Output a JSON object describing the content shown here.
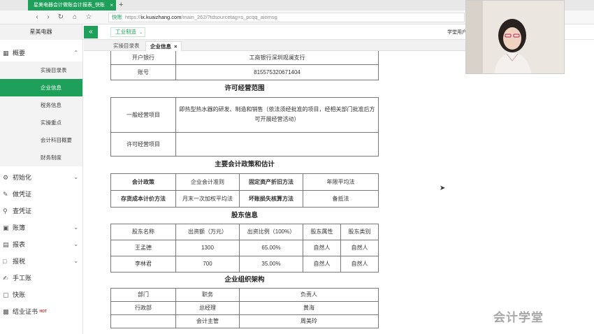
{
  "browser": {
    "tab_title": "星美电器会计做账会计报表_快账",
    "tab_close": "×",
    "new_tab": "+",
    "url_safe": "快账",
    "url_prefix": "https://",
    "url_domain": "ix.kuaizhang.com",
    "url_path": "/main_262/?tdsourcetag=s_pcqq_aiomsg"
  },
  "header": {
    "brand": "星美电器",
    "collapse": "«",
    "industry": "工业制造",
    "study_user": "学堂用户"
  },
  "content_tabs": [
    {
      "label": "实操目录表"
    },
    {
      "label": "企业信息",
      "close": "×"
    }
  ],
  "sidebar": {
    "overview": "概要",
    "subs": [
      "实操目录表",
      "企业信息",
      "税务信息",
      "实操重点",
      "会计科目概要",
      "财务制度"
    ],
    "groups": [
      "初始化",
      "做凭证",
      "查凭证",
      "账簿",
      "报表",
      "报税",
      "手工账",
      "快账",
      "结业证书"
    ],
    "hot": "HOT"
  },
  "bank": {
    "bank_label": "开户银行",
    "bank_value": "工商银行深圳观澜支行",
    "acct_label": "账号",
    "acct_value": "815575320671404"
  },
  "scope": {
    "title": "许可经营范围",
    "general_label": "一般经营项目",
    "general_value": "即热型热水器的研发、制造和销售（依法须经批准的项目，经相关部门批准后方可开展经营活动）",
    "licensed_label": "许可经营项目",
    "licensed_value": ""
  },
  "policy": {
    "title": "主要会计政策和估计",
    "r1": [
      "会计政策",
      "企业会计准则",
      "固定资产折旧方法",
      "年限平均法"
    ],
    "r2": [
      "存货成本计价方法",
      "月末一次加权平均法",
      "坏账损失核算方法",
      "备抵法"
    ]
  },
  "shareholders": {
    "title": "股东信息",
    "header": [
      "股东名称",
      "出资额（万元）",
      "出资比例（100%）",
      "股东属性",
      "股东类别"
    ],
    "rows": [
      [
        "王孟德",
        "1300",
        "65.00%",
        "自然人",
        "自然人"
      ],
      [
        "李林君",
        "700",
        "35.00%",
        "自然人",
        "自然人"
      ]
    ]
  },
  "org": {
    "title": "企业组织架构",
    "header": [
      "部门",
      "职务",
      "负责人"
    ],
    "rows": [
      [
        "行政部",
        "总经理",
        "黄海"
      ],
      [
        "",
        "会计主管",
        "周美玲"
      ]
    ]
  },
  "watermark": "会计学堂",
  "colors": {
    "accent": "#1fa05a"
  }
}
